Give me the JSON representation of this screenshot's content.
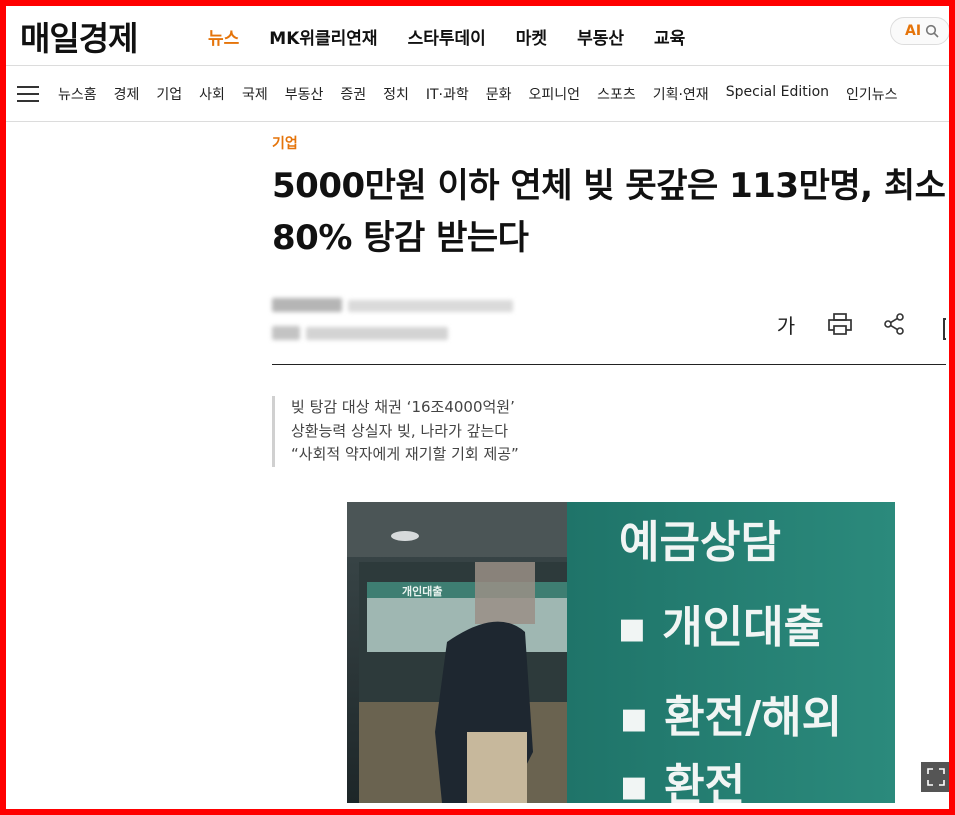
{
  "header": {
    "logo": "매일경제",
    "nav": [
      "뉴스",
      "MK위클리연재",
      "스타투데이",
      "마켓",
      "부동산",
      "교육"
    ],
    "active_nav": "뉴스",
    "ai_label": "AI"
  },
  "subnav": {
    "items": [
      "뉴스홈",
      "경제",
      "기업",
      "사회",
      "국제",
      "부동산",
      "증권",
      "정치",
      "IT·과학",
      "문화",
      "오피니언",
      "스포츠",
      "기획·연재",
      "Special Edition",
      "인기뉴스"
    ]
  },
  "article": {
    "section": "기업",
    "headline_line1": "5000만원 이하 연체 빚 못갚은 113만명, 최소",
    "headline_line2": "80% 탕감 받는다",
    "font_size_button": "가",
    "summary": [
      "빚 탕감 대상 채권 ‘16조4000억원’",
      "상환능력 상실자 빚, 나라가 갚는다",
      "“사회적 약자에게 재기할 기회 제공”"
    ]
  },
  "photo": {
    "signs": [
      "예금상담",
      "▪ 개인대출",
      "▪ 환전/해외",
      "▪ 환전"
    ],
    "window_sign": "개인대출"
  },
  "colors": {
    "accent": "#e5740a",
    "frame": "#ff0000"
  }
}
